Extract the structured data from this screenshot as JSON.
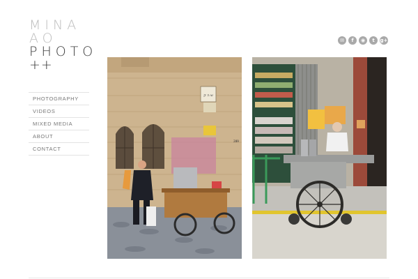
{
  "logo": {
    "line1": "MINA",
    "line2": "AO",
    "line3": "PHOTO",
    "line4": "++"
  },
  "nav": {
    "items": [
      {
        "label": "PHOTOGRAPHY"
      },
      {
        "label": "VIDEOS"
      },
      {
        "label": "MIXED MEDIA"
      },
      {
        "label": "ABOUT"
      },
      {
        "label": "CONTACT"
      }
    ]
  },
  "social": {
    "icons": [
      {
        "name": "email-icon",
        "glyph": "✉"
      },
      {
        "name": "facebook-icon",
        "glyph": "f"
      },
      {
        "name": "flickr-icon",
        "glyph": "◉"
      },
      {
        "name": "twitter-icon",
        "glyph": "t"
      },
      {
        "name": "google-plus-icon",
        "glyph": "g+"
      }
    ]
  },
  "photos": [
    {
      "name": "photo-street-vendor-stone-wall",
      "sign_text": "ש ה ק",
      "number_text": "289"
    },
    {
      "name": "photo-street-vendor-cart-shop"
    }
  ],
  "colors": {
    "logo_light": "#bdbdbd",
    "logo_dark": "#3a3a3a",
    "nav_text": "#777777",
    "divider": "#e3e3e3",
    "icon_bg": "#a9a9a9"
  }
}
